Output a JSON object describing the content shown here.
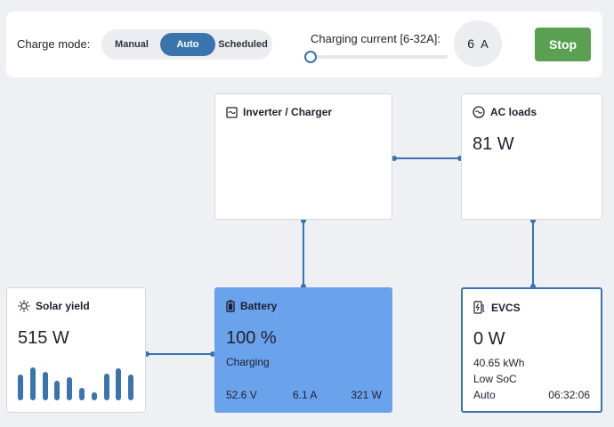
{
  "topbar": {
    "charge_mode_label": "Charge mode:",
    "modes": [
      "Manual",
      "Auto",
      "Scheduled"
    ],
    "selected_mode": "Auto",
    "charging_current_label": "Charging current [6-32A]:",
    "current_value": "6",
    "current_unit": "A",
    "slider_min": 6,
    "slider_max": 32,
    "slider_value": 6,
    "stop_label": "Stop"
  },
  "colors": {
    "accent": "#3a74ad",
    "stop": "#5aa052",
    "battery_card": "#6aa2ec",
    "background": "#eef0f4"
  },
  "inverter": {
    "title": "Inverter / Charger",
    "icon": "inverter-icon"
  },
  "acloads": {
    "title": "AC loads",
    "icon": "ac-wave-icon",
    "power": "81 W"
  },
  "solar": {
    "title": "Solar yield",
    "icon": "sun-icon",
    "power": "515 W",
    "history": [
      0.76,
      0.97,
      0.84,
      0.58,
      0.68,
      0.37,
      0.24,
      0.79,
      0.95,
      0.76
    ]
  },
  "battery": {
    "title": "Battery",
    "icon": "battery-icon",
    "soc": "100 %",
    "state": "Charging",
    "voltage": "52.6 V",
    "current": "6.1 A",
    "power": "321 W"
  },
  "evcs": {
    "title": "EVCS",
    "icon": "ev-charger-icon",
    "power": "0 W",
    "energy": "40.65 kWh",
    "status": "Low SoC",
    "mode": "Auto",
    "time": "06:32:06"
  }
}
